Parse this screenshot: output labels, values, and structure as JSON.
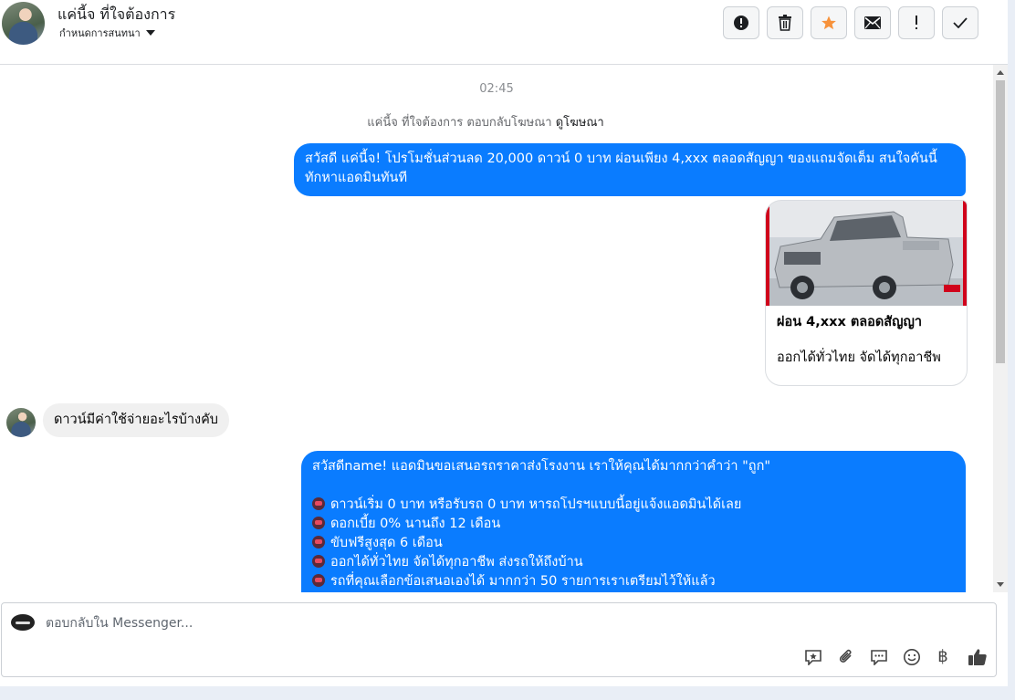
{
  "header": {
    "contact_name": "แค่นี้จ ที่ใจต้องการ",
    "conversation_settings": "กำหนดการสนทนา",
    "actions": [
      {
        "name": "report-spam",
        "icon": "alert-circle-icon"
      },
      {
        "name": "delete",
        "icon": "trash-icon"
      },
      {
        "name": "star",
        "icon": "star-icon",
        "color": "#f7923b"
      },
      {
        "name": "mark-unread",
        "icon": "envelope-icon"
      },
      {
        "name": "follow-up",
        "icon": "exclamation-icon"
      },
      {
        "name": "mark-done",
        "icon": "checkmark-icon"
      }
    ]
  },
  "thread": {
    "timestamp": "02:45",
    "ad_reply_text": "แค่นี้จ ที่ใจต้องการ ตอบกลับโฆษณา",
    "ad_link": "ดูโฆษณา",
    "msg1_line1": "สวัสดี แค่นี้จ! โปรโมชั่นส่วนลด 20,000 ดาวน์ 0 บาท ผ่อนเพียง 4,xxx ตลอดสัญญา ของแถมจัดเต็ม สนใจคันนี้",
    "msg1_line2": "ทักหาแอดมินทันที",
    "card_title": "ผ่อน 4,xxx ตลอดสัญญา",
    "card_subtitle": "ออกได้ทั่วไทย จัดได้ทุกอาชีพ",
    "incoming_msg": "ดาวน์มีค่าใช้จ่ายอะไรบ้างคับ",
    "msg2_intro": "สวัสดีname! แอดมินขอเสนอรถราคาส่งโรงงาน เราให้คุณได้มากกว่าคำว่า \"ถูก\"",
    "msg2_bullets": [
      "ดาวน์เริ่ม 0 บาท หรือรับรถ 0 บาท หารถโปรฯแบบนี้อยู่แจ้งแอดมินได้เลย",
      "ดอกเบี้ย 0% นานถึง 12 เดือน",
      "ขับฟรีสูงสุด 6 เดือน",
      "ออกได้ทั่วไทย จัดได้ทุกอาชีพ ส่งรถให้ถึงบ้าน",
      "รถที่คุณเลือกข้อเสนอเองได้ มากกว่า 50 รายการเราเตรียมไว้ให้แล้ว"
    ]
  },
  "composer": {
    "placeholder": "ตอบกลับใน Messenger...",
    "value": "",
    "tools": [
      "saved-reply-icon",
      "attach-icon",
      "chat-bubble-icon",
      "emoji-icon",
      "baht-icon",
      "thumbs-up-icon"
    ],
    "baht_glyph": "฿"
  },
  "colors": {
    "outgoing_bubble": "#0a7cff",
    "incoming_bubble": "#f0f0f0",
    "star": "#f7923b"
  }
}
